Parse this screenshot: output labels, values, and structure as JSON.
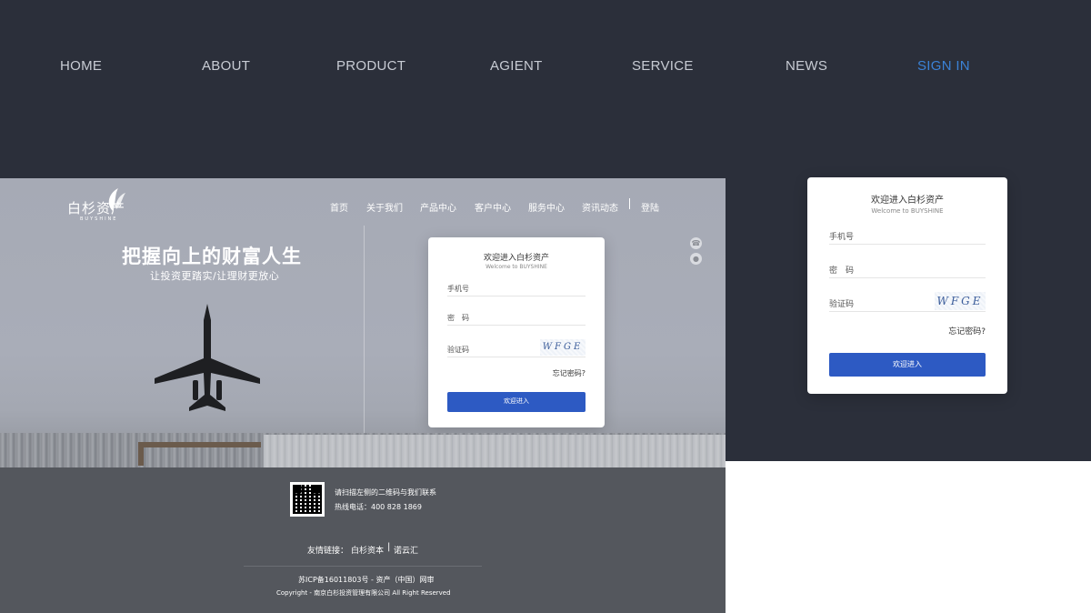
{
  "topnav": {
    "items": [
      {
        "label": "HOME"
      },
      {
        "label": "ABOUT"
      },
      {
        "label": "PRODUCT"
      },
      {
        "label": "AGIENT"
      },
      {
        "label": "SERVICE"
      },
      {
        "label": "NEWS"
      },
      {
        "label": "SIGN IN"
      }
    ],
    "active_color": "#3b82d6"
  },
  "site": {
    "logo_text": "白杉资产",
    "logo_sub": "BUYSHINE",
    "nav": [
      "首页",
      "关于我们",
      "产品中心",
      "客户中心",
      "服务中心",
      "资讯动态",
      "登陆"
    ],
    "hero_title": "把握向上的财富人生",
    "hero_subtitle": "让投资更踏实/让理财更放心"
  },
  "login": {
    "title": "欢迎进入白杉资产",
    "subtitle": "Welcome to BUYSHINE",
    "phone_label": "手机号",
    "password_label": "密　码",
    "captcha_label": "验证码",
    "captcha_text": "WFGE",
    "forgot": "忘记密码?",
    "submit": "欢迎进入",
    "button_color": "#2d5ac3"
  },
  "footer": {
    "qr_text": "请扫描左侧的二维码与我们联系",
    "hotline": "热线电话：400 828 1869",
    "links_label": "友情链接：",
    "links": [
      "白杉资本",
      "诺云汇"
    ],
    "icp": "苏ICP备16011803号 - 资产（中国）网审",
    "copyright": "Copyright - 南京白杉投资管理有限公司 All Right Reserved"
  }
}
